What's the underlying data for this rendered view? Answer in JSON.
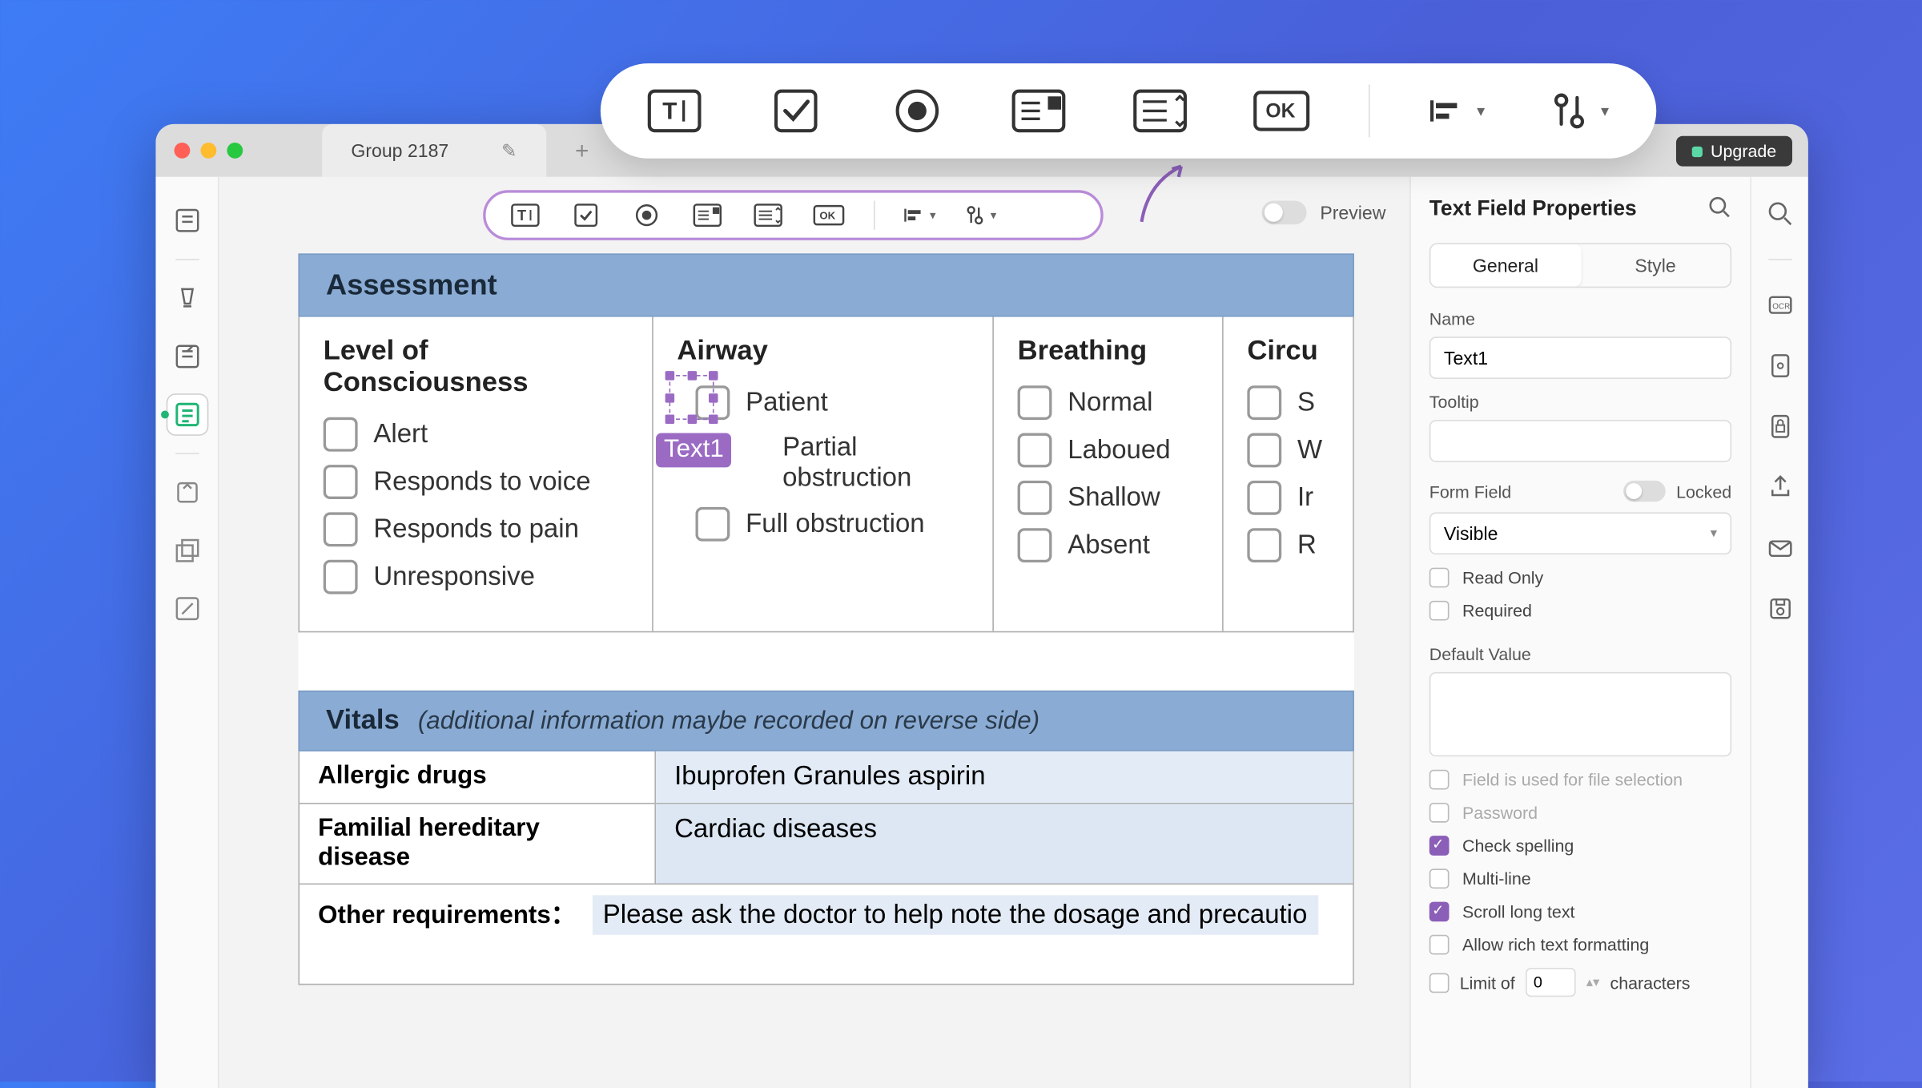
{
  "window": {
    "tab_title": "Group 2187",
    "upgrade_label": "Upgrade"
  },
  "floating_toolbar": {
    "items": [
      "text-field",
      "checkbox",
      "radio",
      "dropdown",
      "list",
      "ok-button",
      "align",
      "tools"
    ]
  },
  "inner_toolbar": {
    "preview_label": "Preview"
  },
  "document": {
    "assessment": {
      "header": "Assessment",
      "columns": [
        {
          "title": "Level of Consciousness",
          "options": [
            "Alert",
            "Responds to voice",
            "Responds to pain",
            "Unresponsive"
          ]
        },
        {
          "title": "Airway",
          "options": [
            "Patient",
            "Partial obstruction",
            "Full obstruction"
          ]
        },
        {
          "title": "Breathing",
          "options": [
            "Normal",
            "Laboued",
            "Shallow",
            "Absent"
          ]
        },
        {
          "title": "Circu",
          "options": [
            "S",
            "W",
            "Ir",
            "R"
          ]
        }
      ]
    },
    "selected_field_label": "Text1",
    "vitals": {
      "header": "Vitals",
      "subheader": "(additional information maybe recorded on reverse side)",
      "rows": [
        {
          "label": "Allergic drugs",
          "value": "Ibuprofen Granules  aspirin"
        },
        {
          "label": "Familial hereditary disease",
          "value": "Cardiac diseases"
        }
      ],
      "other_label": "Other requirements：",
      "other_value": "Please ask the doctor to help note the dosage and precautio"
    }
  },
  "properties": {
    "panel_title": "Text Field Properties",
    "tabs": {
      "general": "General",
      "style": "Style"
    },
    "name_label": "Name",
    "name_value": "Text1",
    "tooltip_label": "Tooltip",
    "tooltip_value": "",
    "form_field_label": "Form Field",
    "locked_label": "Locked",
    "visibility_value": "Visible",
    "readonly_label": "Read Only",
    "required_label": "Required",
    "default_value_label": "Default Value",
    "default_value": "",
    "file_selection_label": "Field is used for file selection",
    "password_label": "Password",
    "check_spelling_label": "Check spelling",
    "multiline_label": "Multi-line",
    "scroll_long_label": "Scroll long text",
    "rich_text_label": "Allow rich text formatting",
    "limit_prefix": "Limit of",
    "limit_value": "0",
    "limit_suffix": "characters"
  }
}
